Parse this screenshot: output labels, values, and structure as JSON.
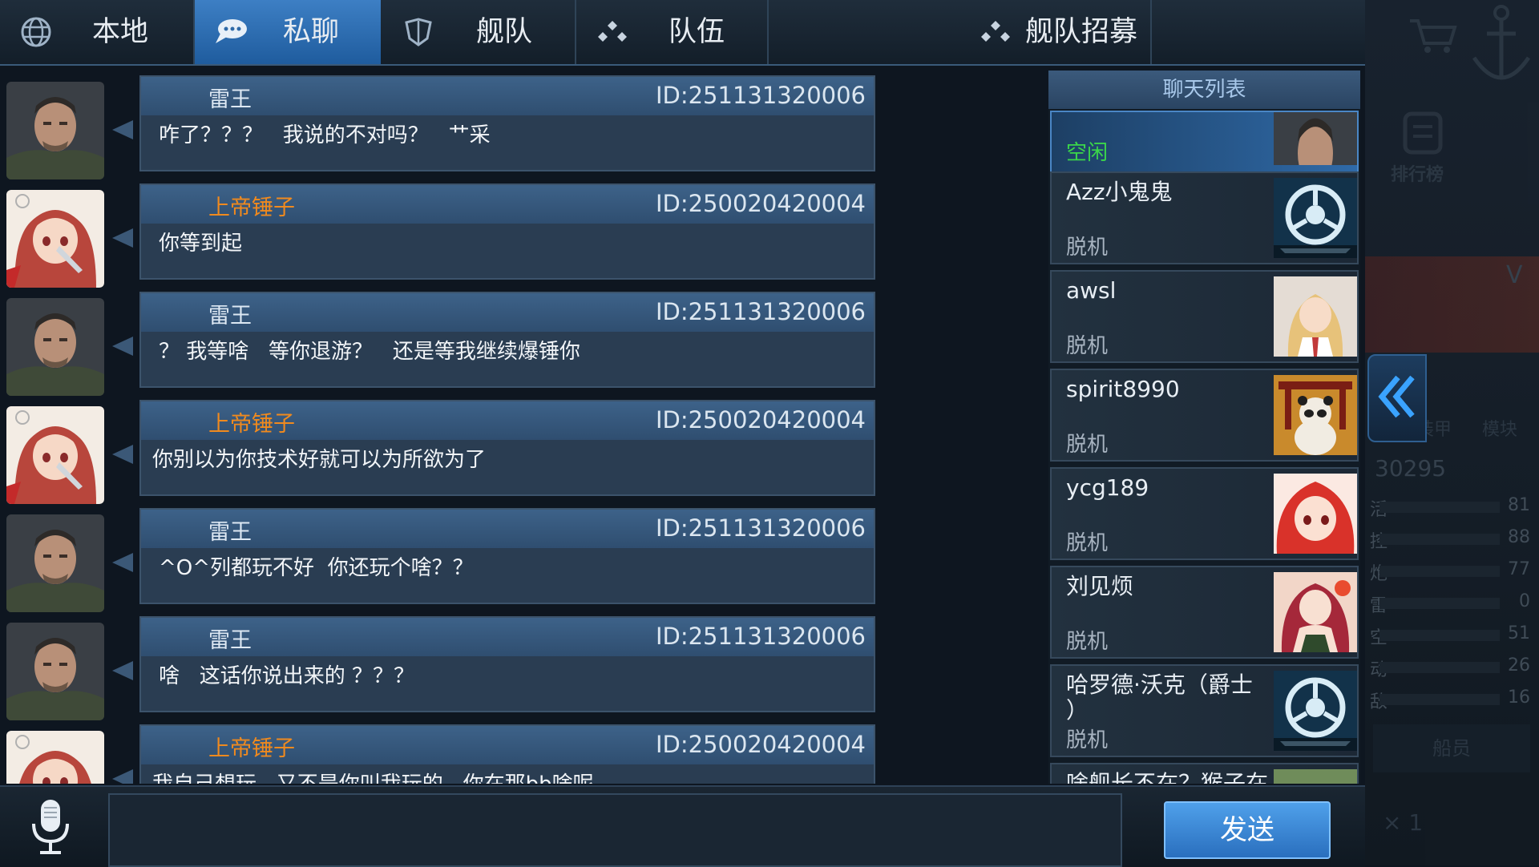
{
  "tabs": [
    {
      "label": "本地",
      "icon": "globe-icon"
    },
    {
      "label": "私聊",
      "icon": "chat-bubble-icon"
    },
    {
      "label": "舰队",
      "icon": "shield-icon"
    },
    {
      "label": "队伍",
      "icon": "team-dots-icon"
    },
    {
      "label": "舰队招募",
      "icon": "recruit-dots-icon"
    }
  ],
  "messages": [
    {
      "sender": "雷王",
      "id": "ID:251131320006",
      "text": "咋了？？？   我说的不对吗？   艹采",
      "avatar": "soldier-avatar",
      "color": "#dde8f3"
    },
    {
      "sender": "上帝锤子",
      "id": "ID:250020420004",
      "text": "你等到起",
      "avatar": "anime-girl-avatar",
      "color": "#f08a1e"
    },
    {
      "sender": "雷王",
      "id": "ID:251131320006",
      "text": "？ 我等啥   等你退游？   还是等我继续爆锤你",
      "avatar": "soldier-avatar",
      "color": "#dde8f3"
    },
    {
      "sender": "上帝锤子",
      "id": "ID:250020420004",
      "text": "你别以为你技术好就可以为所欲为了",
      "avatar": "anime-girl-avatar",
      "color": "#f08a1e"
    },
    {
      "sender": "雷王",
      "id": "ID:251131320006",
      "text": "^O^列都玩不好  你还玩个啥？？",
      "avatar": "soldier-avatar",
      "color": "#dde8f3"
    },
    {
      "sender": "雷王",
      "id": "ID:251131320006",
      "text": "啥   这话你说出来的 ？？？",
      "avatar": "soldier-avatar",
      "color": "#dde8f3"
    },
    {
      "sender": "上帝锤子",
      "id": "ID:250020420004",
      "text": "我自己想玩   又不是你叫我玩的   你在那bb啥呢",
      "avatar": "anime-girl-avatar",
      "color": "#f08a1e"
    }
  ],
  "chat_list": {
    "title": "聊天列表",
    "contacts": [
      {
        "name": "",
        "status": "空闲",
        "selected": true,
        "avatar": "soldier-avatar"
      },
      {
        "name": "Azz小鬼鬼",
        "status": "脱机",
        "selected": false,
        "avatar": "fleet-emblem-avatar"
      },
      {
        "name": "awsl",
        "status": "脱机",
        "selected": false,
        "avatar": "blonde-girl-avatar"
      },
      {
        "name": "spirit8990",
        "status": "脱机",
        "selected": false,
        "avatar": "panda-avatar"
      },
      {
        "name": "ycg189",
        "status": "脱机",
        "selected": false,
        "avatar": "red-hair-girl-avatar"
      },
      {
        "name": "刘见烦",
        "status": "脱机",
        "selected": false,
        "avatar": "anime-woman-avatar"
      },
      {
        "name": "哈罗德·沃克（爵士\n）",
        "status": "脱机",
        "selected": false,
        "avatar": "fleet-emblem-avatar"
      },
      {
        "name": "啥舰长不在？猴子在",
        "status": "",
        "selected": false,
        "avatar": "landscape-avatar"
      }
    ]
  },
  "side_panel": {
    "ranking_label": "排行榜",
    "armor_label": "装甲",
    "module_label": "模块",
    "letter": "V",
    "power": "30295",
    "stats": [
      {
        "label": "活",
        "value": "81"
      },
      {
        "label": "控",
        "value": "88"
      },
      {
        "label": "炮",
        "value": "77"
      },
      {
        "label": "雷",
        "value": "0"
      },
      {
        "label": "空",
        "value": "51"
      },
      {
        "label": "动",
        "value": "26"
      },
      {
        "label": "敌",
        "value": "16"
      }
    ],
    "crew_label": "船员",
    "count": "× 1"
  },
  "input": {
    "value": "",
    "placeholder": ""
  },
  "send_label": "发送",
  "colors": {
    "accent": "#2f6aa8",
    "orange_name": "#f08a1e",
    "idle_green": "#3bd64a"
  }
}
